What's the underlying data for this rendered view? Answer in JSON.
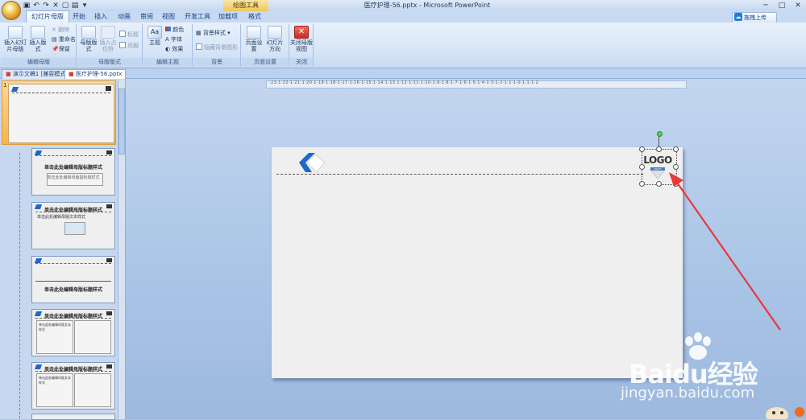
{
  "window": {
    "title": "医疗护理-56.pptx - Microsoft PowerPoint",
    "context_tab": "绘图工具",
    "controls": [
      "─",
      "□",
      "✕"
    ]
  },
  "qat_icons": [
    "save-icon",
    "undo-icon",
    "redo-icon",
    "close-icon",
    "new-icon",
    "print-icon",
    "dropdown-icon"
  ],
  "tabs": [
    {
      "label": "幻灯片母版",
      "active": true
    },
    {
      "label": "开始"
    },
    {
      "label": "插入"
    },
    {
      "label": "动画"
    },
    {
      "label": "审阅"
    },
    {
      "label": "视图"
    },
    {
      "label": "开发工具"
    },
    {
      "label": "加载项"
    },
    {
      "label": "格式"
    }
  ],
  "upload_label": "拖拽上传",
  "ribbon": {
    "edit_master": {
      "label": "编辑母版",
      "insert_master": "插入幻灯片母版",
      "insert_layout": "插入版式",
      "delete": "删除",
      "rename": "重命名",
      "preserve": "保留"
    },
    "master_layout": {
      "label": "母版版式",
      "master_layout_btn": "母版版式",
      "insert_placeholder": "插入占位符",
      "title": "标题",
      "footer": "页脚"
    },
    "edit_theme": {
      "label": "编辑主题",
      "theme": "主题",
      "colors": "颜色",
      "fonts": "字体",
      "effects": "效果"
    },
    "background": {
      "label": "背景",
      "bg_styles": "背景样式",
      "hide_bg": "隐藏背景图形"
    },
    "page_setup": {
      "label": "页面设置",
      "page_setup_btn": "页面设置",
      "orientation": "幻灯片方向"
    },
    "close": {
      "label": "关闭",
      "close_master": "关闭母版视图"
    }
  },
  "doc_tabs": [
    {
      "label": "演示文稿1 [兼容模式]"
    },
    {
      "label": "医疗护理-56.pptx",
      "active": true
    }
  ],
  "ruler_text": "·23·1·22·1·21·1·20·1·19·1·18·1·17·1·16·1·15·1·14·1·13·1·12·1·11·1·10·1·9·1·8·1·7·1·6·1·5·1·4·1·3·1·2·1·1·1·0·1·1·1·2",
  "thumbnails": [
    {
      "title": "单击此处编辑母版标题样式",
      "sub": "单击此处编辑母版副标题样式"
    },
    {
      "title": "单击此处编辑母版标题样式",
      "sub": "单击此处编辑母版文本样式"
    },
    {
      "title": "单击此处编辑母版标题样式",
      "sub": ""
    },
    {
      "title": "单击此处编辑母版标题样式",
      "sub": "单击此处编辑母版文本样式"
    },
    {
      "title": "单击此处编辑母版标题样式",
      "sub": "单击此处编辑母版文本样式"
    }
  ],
  "slide": {
    "logo_text": "LOGO",
    "logo_sub": "CRAFT"
  },
  "watermark": {
    "brand": "Baidu经验",
    "site": "jingyan.baidu.com"
  },
  "colors": {
    "accent": "#1f68c9",
    "arrow": "#e8393b"
  }
}
